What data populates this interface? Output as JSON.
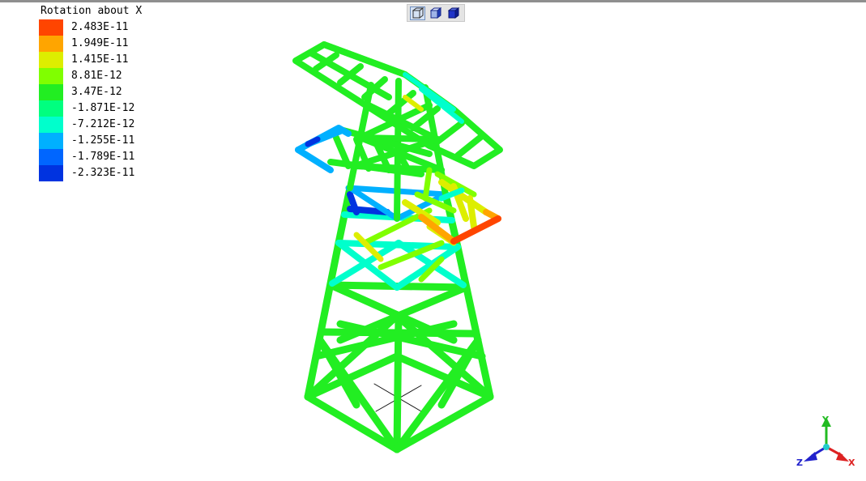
{
  "legend": {
    "title": "Rotation about X",
    "items": [
      {
        "label": "2.483E-11",
        "color": "#ff4500"
      },
      {
        "label": "1.949E-11",
        "color": "#ffa500"
      },
      {
        "label": "1.415E-11",
        "color": "#ddee00"
      },
      {
        "label": "8.81E-12",
        "color": "#80ff00"
      },
      {
        "label": "3.47E-12",
        "color": "#22ee22"
      },
      {
        "label": "-1.871E-12",
        "color": "#00ff7f"
      },
      {
        "label": "-7.212E-12",
        "color": "#00ffcc"
      },
      {
        "label": "-1.255E-11",
        "color": "#00b0ff"
      },
      {
        "label": "-1.789E-11",
        "color": "#0066ff"
      },
      {
        "label": "-2.323E-11",
        "color": "#0033e0"
      }
    ]
  },
  "toolbar": {
    "buttons": [
      {
        "name": "wireframe-view",
        "icon": "wireframe-cube-icon"
      },
      {
        "name": "shaded-view",
        "icon": "shaded-cube-icon"
      },
      {
        "name": "solid-view",
        "icon": "solid-cube-icon"
      }
    ]
  },
  "axis_triad": {
    "y_label": "Y",
    "x_label": "X",
    "z_label": "Z",
    "y_color": "#22bb22",
    "x_color": "#dd2222",
    "z_color": "#2222cc"
  }
}
